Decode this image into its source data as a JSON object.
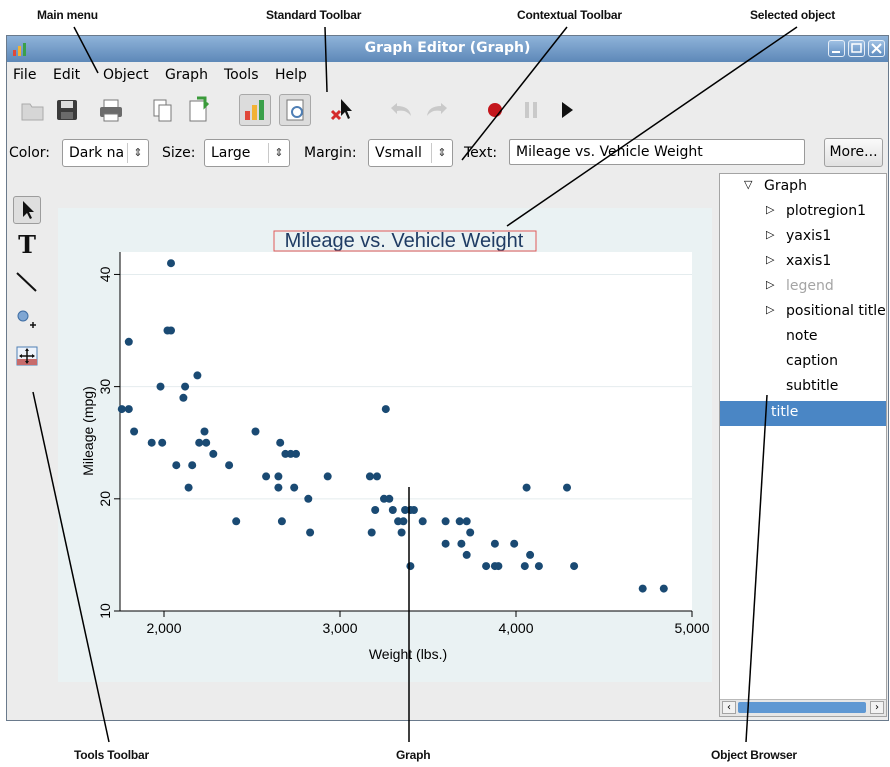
{
  "annotations": {
    "main_menu": "Main menu",
    "standard_toolbar": "Standard Toolbar",
    "contextual_toolbar": "Contextual Toolbar",
    "selected_object": "Selected object",
    "tools_toolbar": "Tools Toolbar",
    "graph": "Graph",
    "object_browser": "Object Browser"
  },
  "window": {
    "title": "Graph Editor (Graph)"
  },
  "menu": [
    "File",
    "Edit",
    "Object",
    "Graph",
    "Tools",
    "Help"
  ],
  "contextual": {
    "color_label": "Color:",
    "color_value": "Dark na",
    "size_label": "Size:",
    "size_value": "Large",
    "margin_label": "Margin:",
    "margin_value": "Vsmall",
    "text_label": "Text:",
    "text_value": "Mileage vs. Vehicle Weight",
    "more_label": "More..."
  },
  "object_browser": {
    "nodes": [
      {
        "label": "Graph"
      },
      {
        "label": "plotregion1"
      },
      {
        "label": "yaxis1"
      },
      {
        "label": "xaxis1"
      },
      {
        "label": "legend"
      },
      {
        "label": "positional titles"
      },
      {
        "label": "note"
      },
      {
        "label": "caption"
      },
      {
        "label": "subtitle"
      },
      {
        "label": "title"
      }
    ],
    "selected": "title"
  },
  "colors": {
    "marker": "#1a4a73",
    "title_text": "#1f3b63",
    "selection_box": "#e05a5a",
    "browser_selection": "#4a86c5",
    "titlebar": "#6f97c4"
  },
  "chart_data": {
    "type": "scatter",
    "title": "Mileage vs. Vehicle Weight",
    "xlabel": "Weight (lbs.)",
    "ylabel": "Mileage (mpg)",
    "xlim": [
      1750,
      5000
    ],
    "ylim": [
      10,
      42
    ],
    "xticks": [
      2000,
      3000,
      4000,
      5000
    ],
    "xtick_labels": [
      "2,000",
      "3,000",
      "4,000",
      "5,000"
    ],
    "yticks": [
      10,
      20,
      30,
      40
    ],
    "ytick_labels": [
      "10",
      "20",
      "30",
      "40"
    ],
    "grid": true,
    "points": [
      [
        1760,
        28
      ],
      [
        1800,
        28
      ],
      [
        1800,
        34
      ],
      [
        1830,
        26
      ],
      [
        1930,
        25
      ],
      [
        1980,
        30
      ],
      [
        1990,
        25
      ],
      [
        2020,
        35
      ],
      [
        2040,
        35
      ],
      [
        2040,
        41
      ],
      [
        2070,
        23
      ],
      [
        2110,
        29
      ],
      [
        2120,
        30
      ],
      [
        2140,
        21
      ],
      [
        2160,
        23
      ],
      [
        2190,
        31
      ],
      [
        2200,
        25
      ],
      [
        2230,
        26
      ],
      [
        2240,
        25
      ],
      [
        2280,
        24
      ],
      [
        2370,
        23
      ],
      [
        2410,
        18
      ],
      [
        2520,
        26
      ],
      [
        2580,
        22
      ],
      [
        2650,
        21
      ],
      [
        2650,
        22
      ],
      [
        2660,
        25
      ],
      [
        2670,
        18
      ],
      [
        2690,
        24
      ],
      [
        2720,
        24
      ],
      [
        2740,
        21
      ],
      [
        2750,
        24
      ],
      [
        2820,
        20
      ],
      [
        2830,
        17
      ],
      [
        2930,
        22
      ],
      [
        3170,
        22
      ],
      [
        3180,
        17
      ],
      [
        3200,
        19
      ],
      [
        3210,
        22
      ],
      [
        3250,
        20
      ],
      [
        3260,
        28
      ],
      [
        3280,
        20
      ],
      [
        3300,
        19
      ],
      [
        3330,
        18
      ],
      [
        3350,
        17
      ],
      [
        3360,
        18
      ],
      [
        3370,
        19
      ],
      [
        3400,
        14
      ],
      [
        3400,
        19
      ],
      [
        3420,
        19
      ],
      [
        3470,
        18
      ],
      [
        3600,
        16
      ],
      [
        3600,
        18
      ],
      [
        3680,
        18
      ],
      [
        3690,
        16
      ],
      [
        3720,
        18
      ],
      [
        3720,
        15
      ],
      [
        3740,
        17
      ],
      [
        3830,
        14
      ],
      [
        3880,
        14
      ],
      [
        3880,
        16
      ],
      [
        3900,
        14
      ],
      [
        3990,
        16
      ],
      [
        4050,
        14
      ],
      [
        4060,
        21
      ],
      [
        4080,
        15
      ],
      [
        4130,
        14
      ],
      [
        4290,
        21
      ],
      [
        4330,
        14
      ],
      [
        4720,
        12
      ],
      [
        4840,
        12
      ]
    ]
  }
}
